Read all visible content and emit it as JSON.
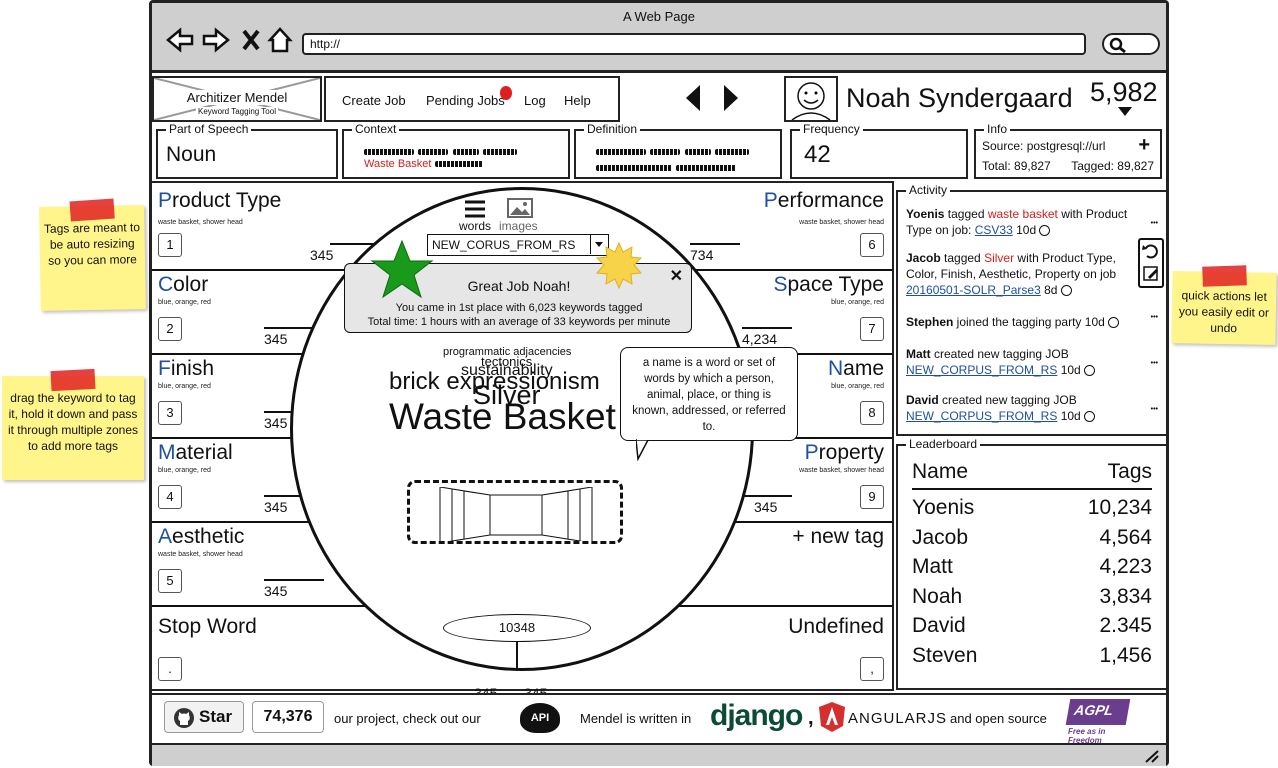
{
  "window": {
    "title": "A Web Page",
    "url": "http://"
  },
  "logo": {
    "title": "Architizer Mendel",
    "subtitle": "Keyword Tagging Tool"
  },
  "nav": {
    "items": [
      "Create Job",
      "Pending Jobs",
      "Log",
      "Help"
    ]
  },
  "user": {
    "name": "Noah Syndergaard",
    "score": "5,982"
  },
  "fields": {
    "part_of_speech": {
      "label": "Part of Speech",
      "value": "Noun"
    },
    "context": {
      "label": "Context",
      "highlight": "Waste Basket"
    },
    "definition": {
      "label": "Definition"
    },
    "frequency": {
      "label": "Frequency",
      "value": "42"
    },
    "info": {
      "label": "Info",
      "source": "Source: postgresql://url",
      "total": "Total: 89,827",
      "tagged": "Tagged: 89,827"
    }
  },
  "zones": {
    "left": [
      {
        "title_cap": "P",
        "title_rest": "roduct Type",
        "sub": "waste basket, shower head",
        "key": "1",
        "count": "345"
      },
      {
        "title_cap": "C",
        "title_rest": "olor",
        "sub": "blue, orange, red",
        "key": "2",
        "count": "345"
      },
      {
        "title_cap": "F",
        "title_rest": "inish",
        "sub": "blue, orange, red",
        "key": "3",
        "count": "345"
      },
      {
        "title_cap": "M",
        "title_rest": "aterial",
        "sub": "blue, orange, red",
        "key": "4",
        "count": "345"
      },
      {
        "title_cap": "A",
        "title_rest": "esthetic",
        "sub": "waste basket, shower head",
        "key": "5",
        "count": "345"
      },
      {
        "title_cap": "",
        "title_rest": "Stop Word",
        "sub": "",
        "key": ".",
        "count": "345"
      }
    ],
    "right": [
      {
        "title_cap": "P",
        "title_rest": "erformance",
        "sub": "waste basket, shower head",
        "key": "6",
        "count": "734"
      },
      {
        "title_cap": "S",
        "title_rest": "pace Type",
        "sub": "blue, orange, red",
        "key": "7",
        "count": "4,234"
      },
      {
        "title_cap": "N",
        "title_rest": "ame",
        "sub": "blue, orange, red",
        "key": "8",
        "count": ""
      },
      {
        "title_cap": "P",
        "title_rest": "roperty",
        "sub": "waste basket, shower head",
        "key": "9",
        "count": "345"
      },
      {
        "title_cap": "",
        "title_rest": "+ new tag",
        "sub": "",
        "key": "",
        "count": ""
      },
      {
        "title_cap": "",
        "title_rest": "Undefined",
        "sub": "",
        "key": ",",
        "count": "345"
      }
    ]
  },
  "center": {
    "tab_words": "words",
    "tab_images": "images",
    "corpus": "NEW_CORUS_FROM_RS",
    "cloud": [
      "programmatic adjacencies",
      "tectonics",
      "sustainability",
      "brick expressionism",
      "Silver"
    ],
    "keyword": "Waste Basket",
    "counter": "10348"
  },
  "popup": {
    "title": "Great Job Noah!",
    "line1": "You came in 1st place with 6,023 keywords tagged",
    "line2": "Total time: 1 hours with an average of 33 keywords per minute"
  },
  "tooltip": {
    "text": "a name is a word or set of words by which a person, animal, place, or thing is known, addressed, or referred to."
  },
  "activity": {
    "label": "Activity",
    "items": [
      {
        "user": "Yoenis",
        "pre": " tagged ",
        "tag": "waste basket",
        "post": " with Product Type on job: ",
        "job": "CSV33",
        "time": "10d"
      },
      {
        "user": "Jacob",
        "pre": " tagged ",
        "tag": "Silver",
        "post": " with Product Type, Color, Finish, Aesthetic, Property on job ",
        "job": "20160501-SOLR_Parse3",
        "time": "8d"
      },
      {
        "user": "Stephen",
        "pre": " joined the tagging party ",
        "tag": "",
        "post": "",
        "job": "",
        "time": "10d"
      },
      {
        "user": "Matt",
        "pre": " created new tagging JOB ",
        "tag": "",
        "post": "",
        "job": "NEW_CORPUS_FROM_RS",
        "time": "10d"
      },
      {
        "user": "David",
        "pre": " created new tagging JOB ",
        "tag": "",
        "post": "",
        "job": "NEW_CORPUS_FROM_RS",
        "time": "10d"
      }
    ]
  },
  "leaderboard": {
    "label": "Leaderboard",
    "col_name": "Name",
    "col_tags": "Tags",
    "rows": [
      {
        "name": "Yoenis",
        "tags": "10,234"
      },
      {
        "name": "Jacob",
        "tags": "4,564"
      },
      {
        "name": "Matt",
        "tags": "4,223"
      },
      {
        "name": "Noah",
        "tags": "3,834"
      },
      {
        "name": "David",
        "tags": "2.345"
      },
      {
        "name": "Steven",
        "tags": "1,456"
      }
    ]
  },
  "notes": {
    "left_top": "Tags are meant to be auto resizing so you can more",
    "left_bottom": "drag the keyword to tag it, hold it down and pass it through multiple zones to add more tags",
    "right": "quick actions let you easily edit or undo"
  },
  "footer": {
    "star": "Star",
    "stars": "74,376",
    "text1": "our project, check out our",
    "api": "API",
    "text2": "Mendel is written in",
    "django": "django",
    "angular": "ANGULARJS",
    "text3": "and open source",
    "agpl": "AGPL",
    "agpl_sub": "Free as in Freedom"
  }
}
